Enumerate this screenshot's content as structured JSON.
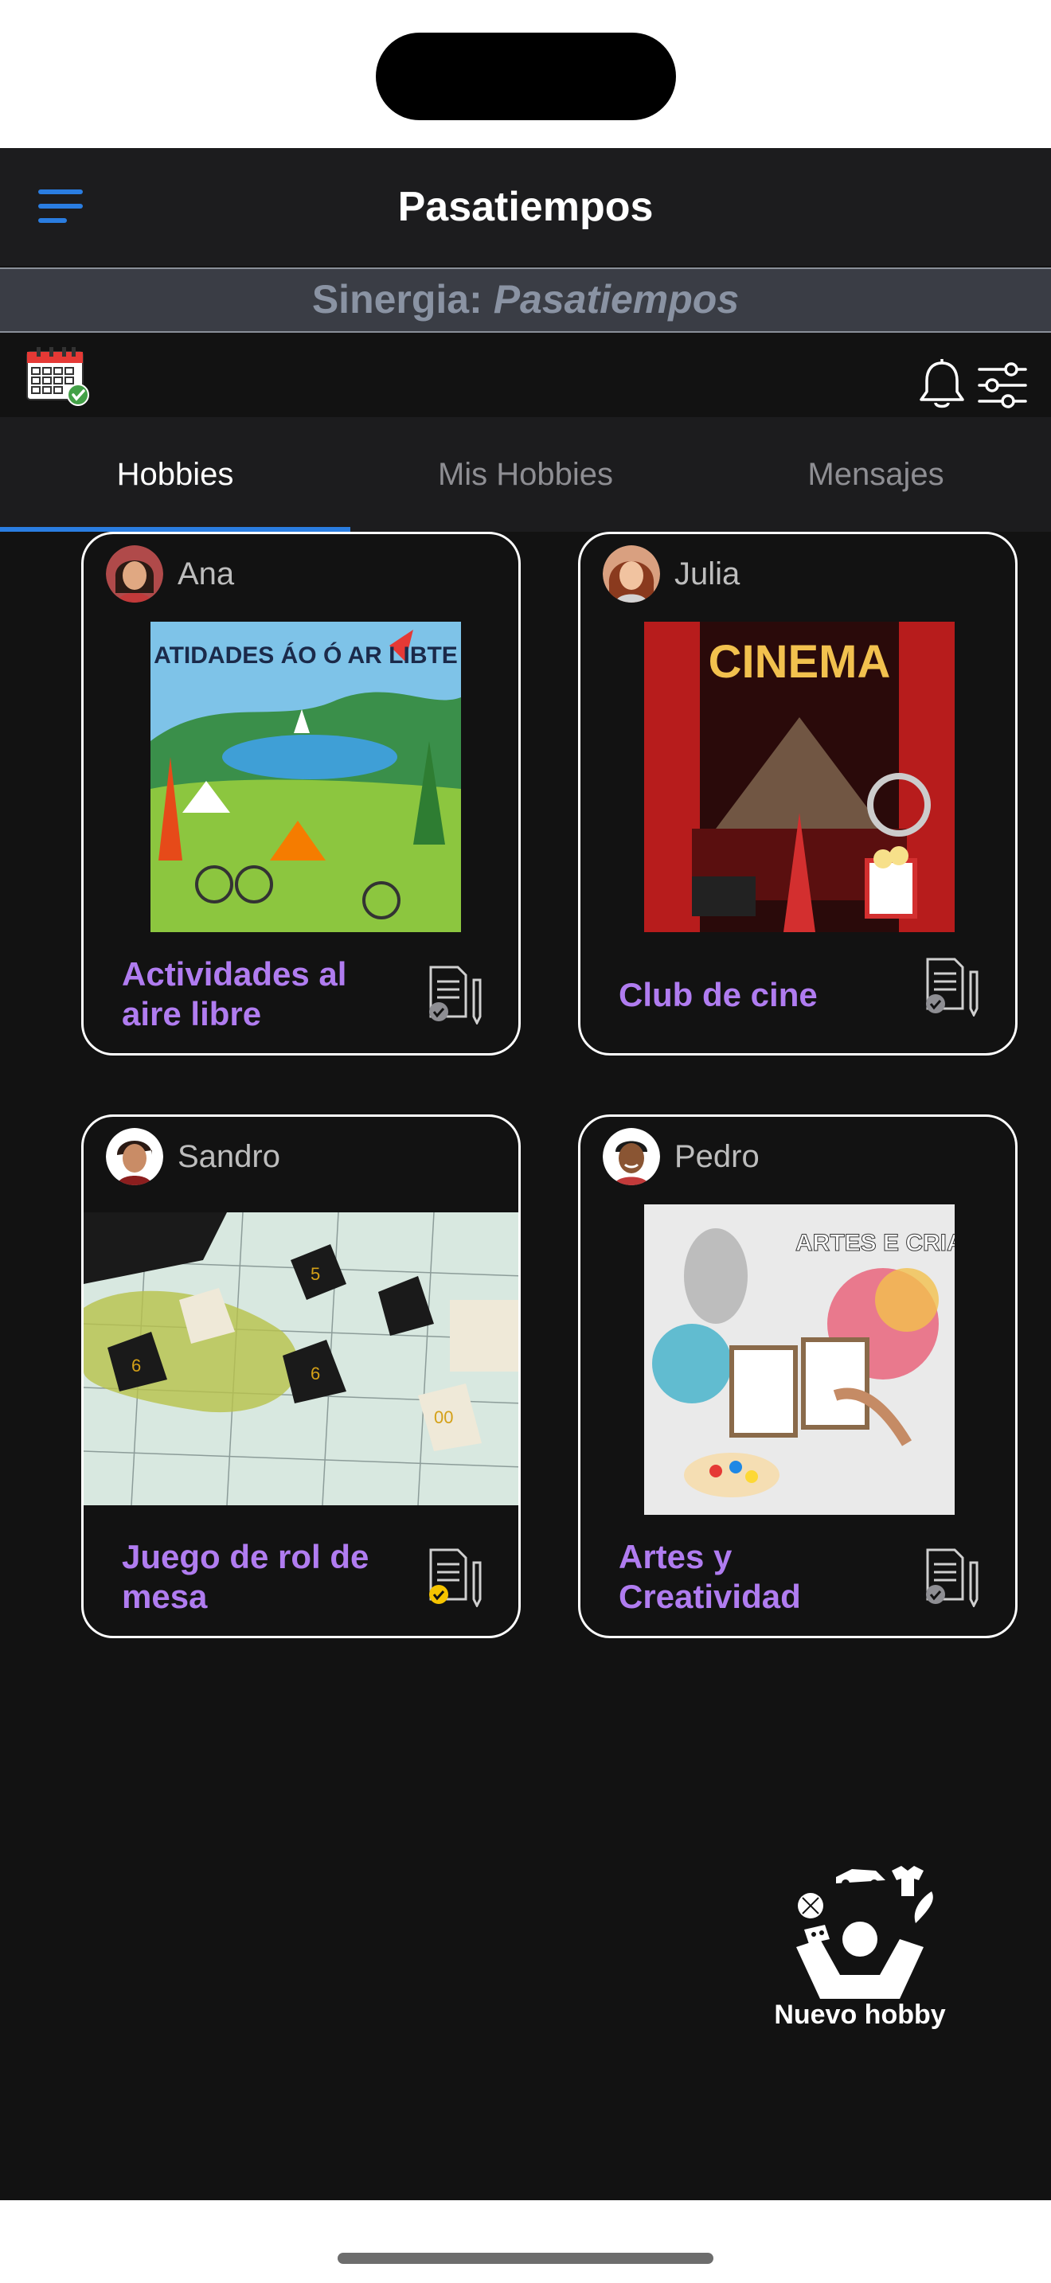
{
  "app": {
    "title": "Pasatiempos",
    "synergy_label": "Sinergia:",
    "synergy_value": "Pasatiempos"
  },
  "tabs": [
    {
      "label": "Hobbies",
      "active": true
    },
    {
      "label": "Mis Hobbies",
      "active": false
    },
    {
      "label": "Mensajes",
      "active": false
    }
  ],
  "icons": {
    "menu": "hamburger-menu-icon",
    "calendar": "calendar-check-icon",
    "bell": "bell-icon",
    "filters": "sliders-icon"
  },
  "hobbies": [
    {
      "owner": "Ana",
      "title": "Actividades al aire libre",
      "image_text": "ATIDADES ÁO Ó AR LIBTE",
      "status": "pending"
    },
    {
      "owner": "Julia",
      "title": "Club de cine",
      "image_text": "CINEMA",
      "status": "pending"
    },
    {
      "owner": "Sandro",
      "title": "Juego de rol de mesa",
      "image_text": "",
      "status": "approved"
    },
    {
      "owner": "Pedro",
      "title": "Artes y Creatividad",
      "image_text": "ARTES E CRIAVIDADE",
      "status": "pending"
    }
  ],
  "fab": {
    "label": "Nuevo hobby"
  },
  "colors": {
    "accent": "#2a7de1",
    "title_purple": "#b07cf0",
    "background": "#121212",
    "status_pending": "#8e8e93",
    "status_approved": "#f5c400"
  }
}
